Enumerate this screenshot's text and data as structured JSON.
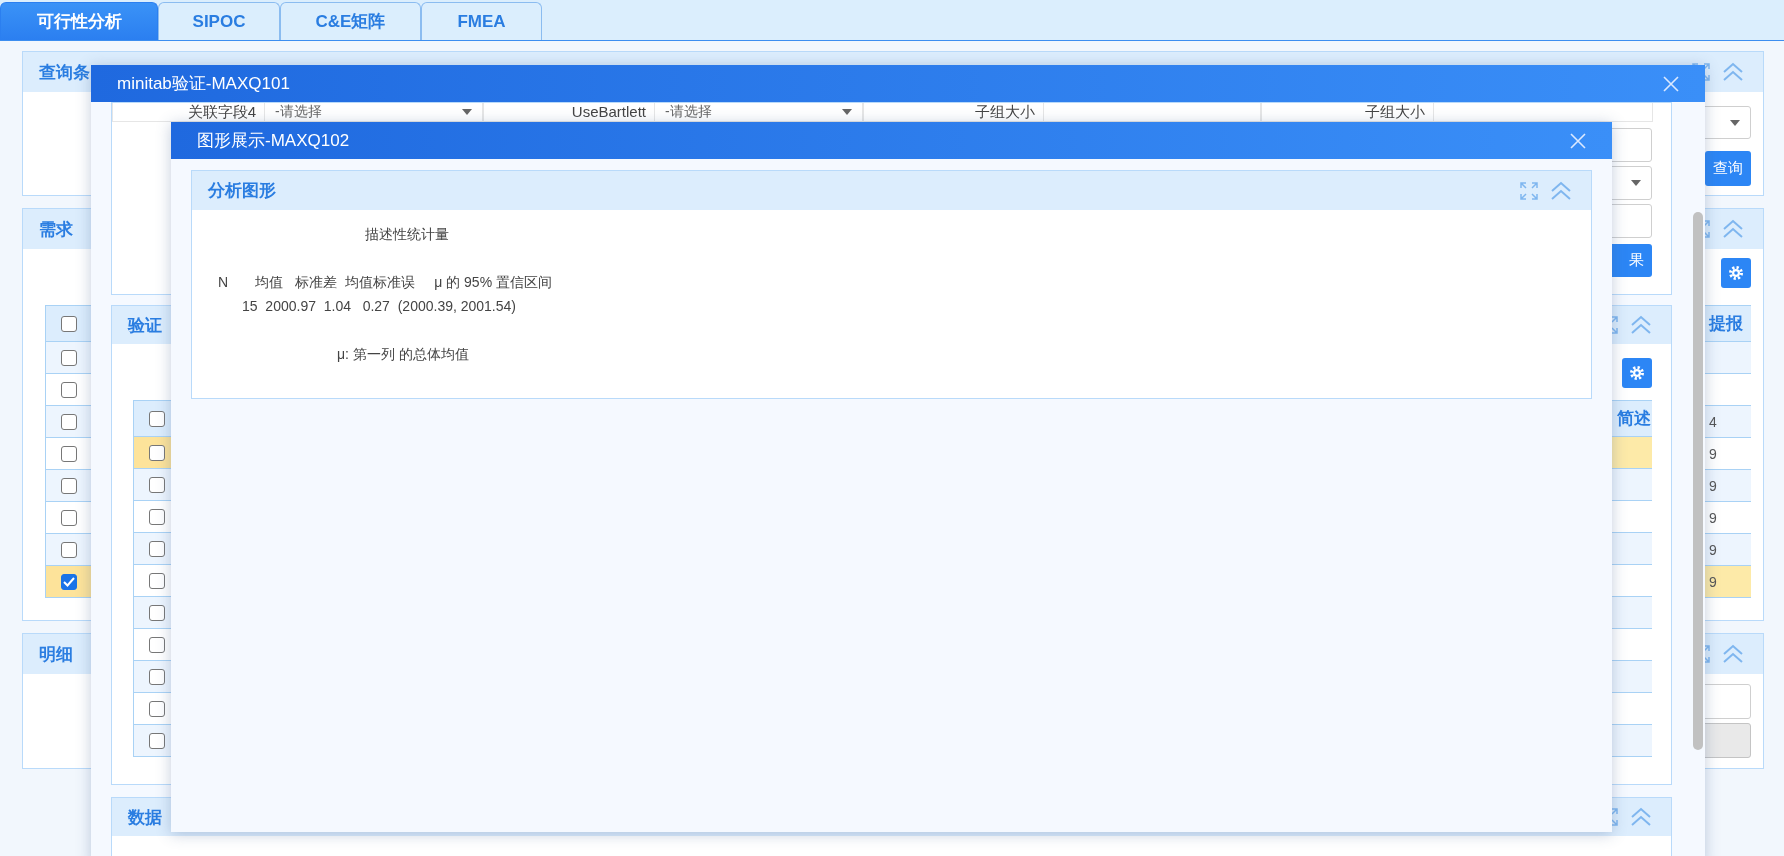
{
  "tabs": [
    {
      "label": "可行性分析",
      "selected": true
    },
    {
      "label": "SIPOC",
      "selected": false
    },
    {
      "label": "C&E矩阵",
      "selected": false
    },
    {
      "label": "FMEA",
      "selected": false
    }
  ],
  "query_panel": {
    "title": "查询条",
    "fields": [
      {
        "kind": "select"
      }
    ],
    "query_button": "查询"
  },
  "demand_panel": {
    "title": "需求",
    "table": {
      "column_header": "提报",
      "header_checked": false,
      "rows": [
        {
          "checked": false,
          "selected": false,
          "cell": ""
        },
        {
          "checked": false,
          "selected": false,
          "cell": ""
        },
        {
          "checked": false,
          "selected": false,
          "cell": "4"
        },
        {
          "checked": false,
          "selected": false,
          "cell": "9"
        },
        {
          "checked": false,
          "selected": false,
          "cell": "9"
        },
        {
          "checked": false,
          "selected": false,
          "cell": "9"
        },
        {
          "checked": false,
          "selected": false,
          "cell": "9"
        },
        {
          "checked": true,
          "selected": true,
          "cell": "9"
        }
      ]
    }
  },
  "detail_panel": {
    "title": "明细",
    "fields": [
      {
        "disabled": false
      },
      {
        "disabled": true
      }
    ]
  },
  "minitab_dialog": {
    "title": "minitab验证-MAXQ101",
    "form": {
      "fields": [
        {
          "label": "关联字段4",
          "kind": "select",
          "placeholder": "-请选择"
        },
        {
          "label": "UseBartlett",
          "kind": "select",
          "placeholder": "-请选择"
        },
        {
          "label": "子组大小",
          "kind": "input"
        },
        {
          "label": "子组大小",
          "kind": "input"
        }
      ],
      "extra_fields": [
        {
          "kind": "input"
        },
        {
          "kind": "select"
        },
        {
          "kind": "input"
        }
      ],
      "result_button": "果"
    },
    "verify_panel": {
      "title": "验证",
      "table": {
        "column_header": "简述",
        "header_checked": false,
        "rows": [
          {
            "checked": false,
            "selected": true
          },
          {
            "checked": false,
            "selected": false
          },
          {
            "checked": false,
            "selected": false
          },
          {
            "checked": false,
            "selected": false
          },
          {
            "checked": false,
            "selected": false
          },
          {
            "checked": false,
            "selected": false
          },
          {
            "checked": false,
            "selected": false
          },
          {
            "checked": false,
            "selected": false
          },
          {
            "checked": false,
            "selected": false
          },
          {
            "checked": false,
            "selected": false
          }
        ]
      }
    },
    "data_panel": {
      "title": "数据"
    }
  },
  "chart_dialog": {
    "title": "图形展示-MAXQ102",
    "panel": {
      "title": "分析图形",
      "lines": [
        {
          "kind": "title",
          "text": "描述性统计量"
        },
        {
          "kind": "header",
          "text": "N       均值   标准差  均值标准误     μ 的 95% 置信区间"
        },
        {
          "kind": "values",
          "text": "15  2000.97  1.04   0.27  (2000.39, 2001.54)"
        },
        {
          "kind": "note",
          "text": "μ: 第一列 的总体均值"
        }
      ]
    }
  }
}
